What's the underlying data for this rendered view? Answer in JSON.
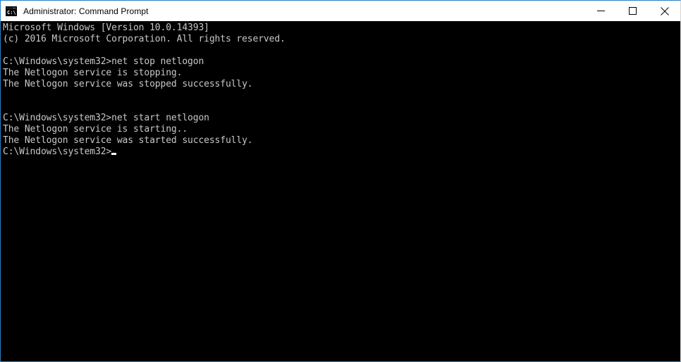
{
  "window": {
    "title": "Administrator: Command Prompt",
    "icon": "command-prompt-icon",
    "icon_label": "C:\\",
    "accent_color": "#2a7ec1",
    "titlebar_background": "#ffffff",
    "controls": {
      "minimize_label": "Minimize",
      "maximize_label": "Maximize",
      "close_label": "Close"
    }
  },
  "console": {
    "background_color": "#000000",
    "foreground_color": "#c8c8c8",
    "cursor": "_",
    "lines": [
      "Microsoft Windows [Version 10.0.14393]",
      "(c) 2016 Microsoft Corporation. All rights reserved.",
      "",
      "C:\\Windows\\system32>net stop netlogon",
      "The Netlogon service is stopping.",
      "The Netlogon service was stopped successfully.",
      "",
      "",
      "C:\\Windows\\system32>net start netlogon",
      "The Netlogon service is starting..",
      "The Netlogon service was started successfully.",
      "",
      ""
    ],
    "prompt": "C:\\Windows\\system32>"
  }
}
